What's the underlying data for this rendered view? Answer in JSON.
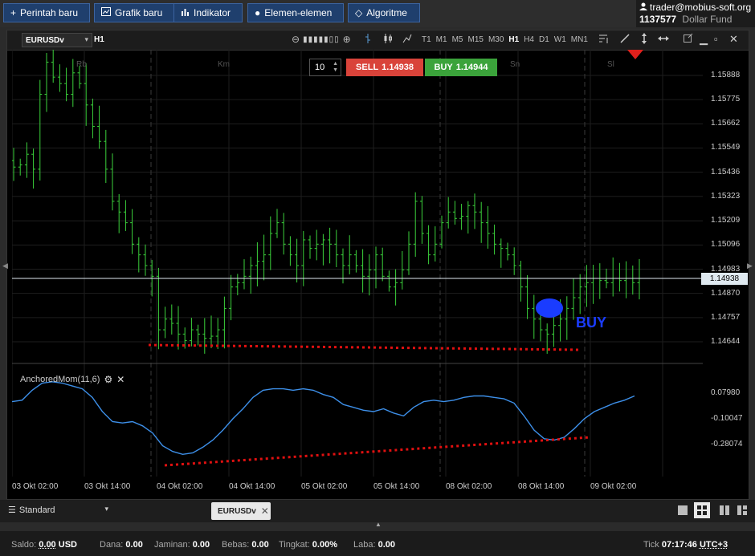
{
  "toolbar": {
    "buttons": [
      {
        "icon": "plus-icon",
        "label": "Perintah baru"
      },
      {
        "icon": "chart-icon",
        "label": "Grafik baru"
      },
      {
        "icon": "bars-icon",
        "label": "Indikator"
      },
      {
        "icon": "elements-icon",
        "label": "Elemen-elemen"
      },
      {
        "icon": "diamond-icon",
        "label": "Algoritme"
      }
    ]
  },
  "account": {
    "email": "trader@mobius-soft.org",
    "number": "1137577",
    "type": "Dollar Fund"
  },
  "chart": {
    "symbol": "EURUSDv",
    "timeframe": "H1",
    "timeframes": [
      "T1",
      "M1",
      "M5",
      "M15",
      "M30",
      "H1",
      "H4",
      "D1",
      "W1",
      "MN1"
    ],
    "active_timeframe": "H1",
    "quantity": "10",
    "sell_label": "SELL",
    "sell_price": "1.14938",
    "buy_label": "BUY",
    "buy_price": "1.14944",
    "day_labels": [
      "Rb",
      "Km",
      "Sn",
      "Sl"
    ],
    "annotation_text": "BUY",
    "indicator_name": "AnchoredMom(11,6)",
    "colors": {
      "background": "#000000",
      "candle": "#3bd23b",
      "sell": "#d9433a",
      "buy": "#3ba33b",
      "indicator_line": "#3d8fe8",
      "trend_dots": "#e01010",
      "buy_marker": "#1a3cff"
    }
  },
  "chart_data": {
    "type": "candlestick",
    "symbol": "EURUSDv",
    "price_axis_ticks": [
      "1.15888",
      "1.15775",
      "1.15662",
      "1.15549",
      "1.15436",
      "1.15323",
      "1.15209",
      "1.15096",
      "1.14983",
      "1.14870",
      "1.14757",
      "1.14644"
    ],
    "current_price": "1.14938",
    "indicator_axis_ticks": [
      "0.07980",
      "-0.10047",
      "-0.28074"
    ],
    "time_axis_labels": [
      "03 Okt 02:00",
      "03 Okt 14:00",
      "04 Okt 02:00",
      "04 Okt 14:00",
      "05 Okt 02:00",
      "05 Okt 14:00",
      "08 Okt 02:00",
      "08 Okt 14:00",
      "09 Okt 02:00"
    ],
    "price_close_series": [
      1.1546,
      1.1547,
      1.1552,
      1.1545,
      1.158,
      1.1595,
      1.1588,
      1.1585,
      1.158,
      1.159,
      1.1585,
      1.1575,
      1.1565,
      1.1558,
      1.1545,
      1.153,
      1.1525,
      1.152,
      1.151,
      1.1505,
      1.15,
      1.1495,
      1.147,
      1.1475,
      1.1473,
      1.1468,
      1.1465,
      1.147,
      1.1468,
      1.1466,
      1.1467,
      1.147,
      1.148,
      1.149,
      1.1492,
      1.1495,
      1.15,
      1.1502,
      1.1505,
      1.1515,
      1.152,
      1.151,
      1.1505,
      1.15,
      1.1512,
      1.1508,
      1.151,
      1.1512,
      1.151,
      1.1505,
      1.15,
      1.1505,
      1.15,
      1.1495,
      1.1498,
      1.1505,
      1.1495,
      1.149,
      1.1492,
      1.1498,
      1.151,
      1.153,
      1.1515,
      1.1505,
      1.151,
      1.152,
      1.1525,
      1.1522,
      1.1523,
      1.1528,
      1.1525,
      1.152,
      1.1515,
      1.151,
      1.1508,
      1.1505,
      1.15,
      1.149,
      1.148,
      1.1475,
      1.147,
      1.1468,
      1.1472,
      1.1475,
      1.148,
      1.1485,
      1.149,
      1.1492,
      1.1494,
      1.1493,
      1.1492,
      1.1494,
      1.1493,
      1.1494,
      1.1492,
      1.1494
    ],
    "indicator_series": [
      0.02,
      0.03,
      0.1,
      0.15,
      0.16,
      0.15,
      0.13,
      0.11,
      0.05,
      -0.05,
      -0.12,
      -0.13,
      -0.12,
      -0.15,
      -0.2,
      -0.29,
      -0.33,
      -0.35,
      -0.34,
      -0.3,
      -0.25,
      -0.18,
      -0.1,
      -0.03,
      0.05,
      0.1,
      0.11,
      0.11,
      0.1,
      0.11,
      0.1,
      0.07,
      0.05,
      0.0,
      -0.02,
      -0.04,
      -0.05,
      -0.03,
      -0.06,
      -0.08,
      -0.02,
      0.02,
      0.03,
      0.02,
      0.03,
      0.05,
      0.06,
      0.06,
      0.05,
      0.04,
      0.01,
      -0.08,
      -0.18,
      -0.24,
      -0.25,
      -0.23,
      -0.17,
      -0.1,
      -0.05,
      -0.02,
      0.01,
      0.03,
      0.06
    ],
    "annotations": [
      "BUY",
      "price support trendline (red dotted)",
      "indicator rising trendline (red dotted)",
      "buy marker (blue ellipse)"
    ]
  },
  "bottom": {
    "workspace": "Standard",
    "tab_label": "EURUSDv",
    "layouts": [
      "layout-single-icon",
      "layout-grid-icon",
      "layout-columns-icon",
      "layout-rows-icon"
    ]
  },
  "status": {
    "saldo_label": "Saldo:",
    "saldo_value": "0.00",
    "saldo_currency": "USD",
    "dana_label": "Dana:",
    "dana_value": "0.00",
    "jaminan_label": "Jaminan:",
    "jaminan_value": "0.00",
    "bebas_label": "Bebas:",
    "bebas_value": "0.00",
    "tingkat_label": "Tingkat:",
    "tingkat_value": "0.00%",
    "laba_label": "Laba:",
    "laba_value": "0.00",
    "tick_label": "Tick",
    "time": "07:17:46",
    "timezone": "UTC+3"
  }
}
